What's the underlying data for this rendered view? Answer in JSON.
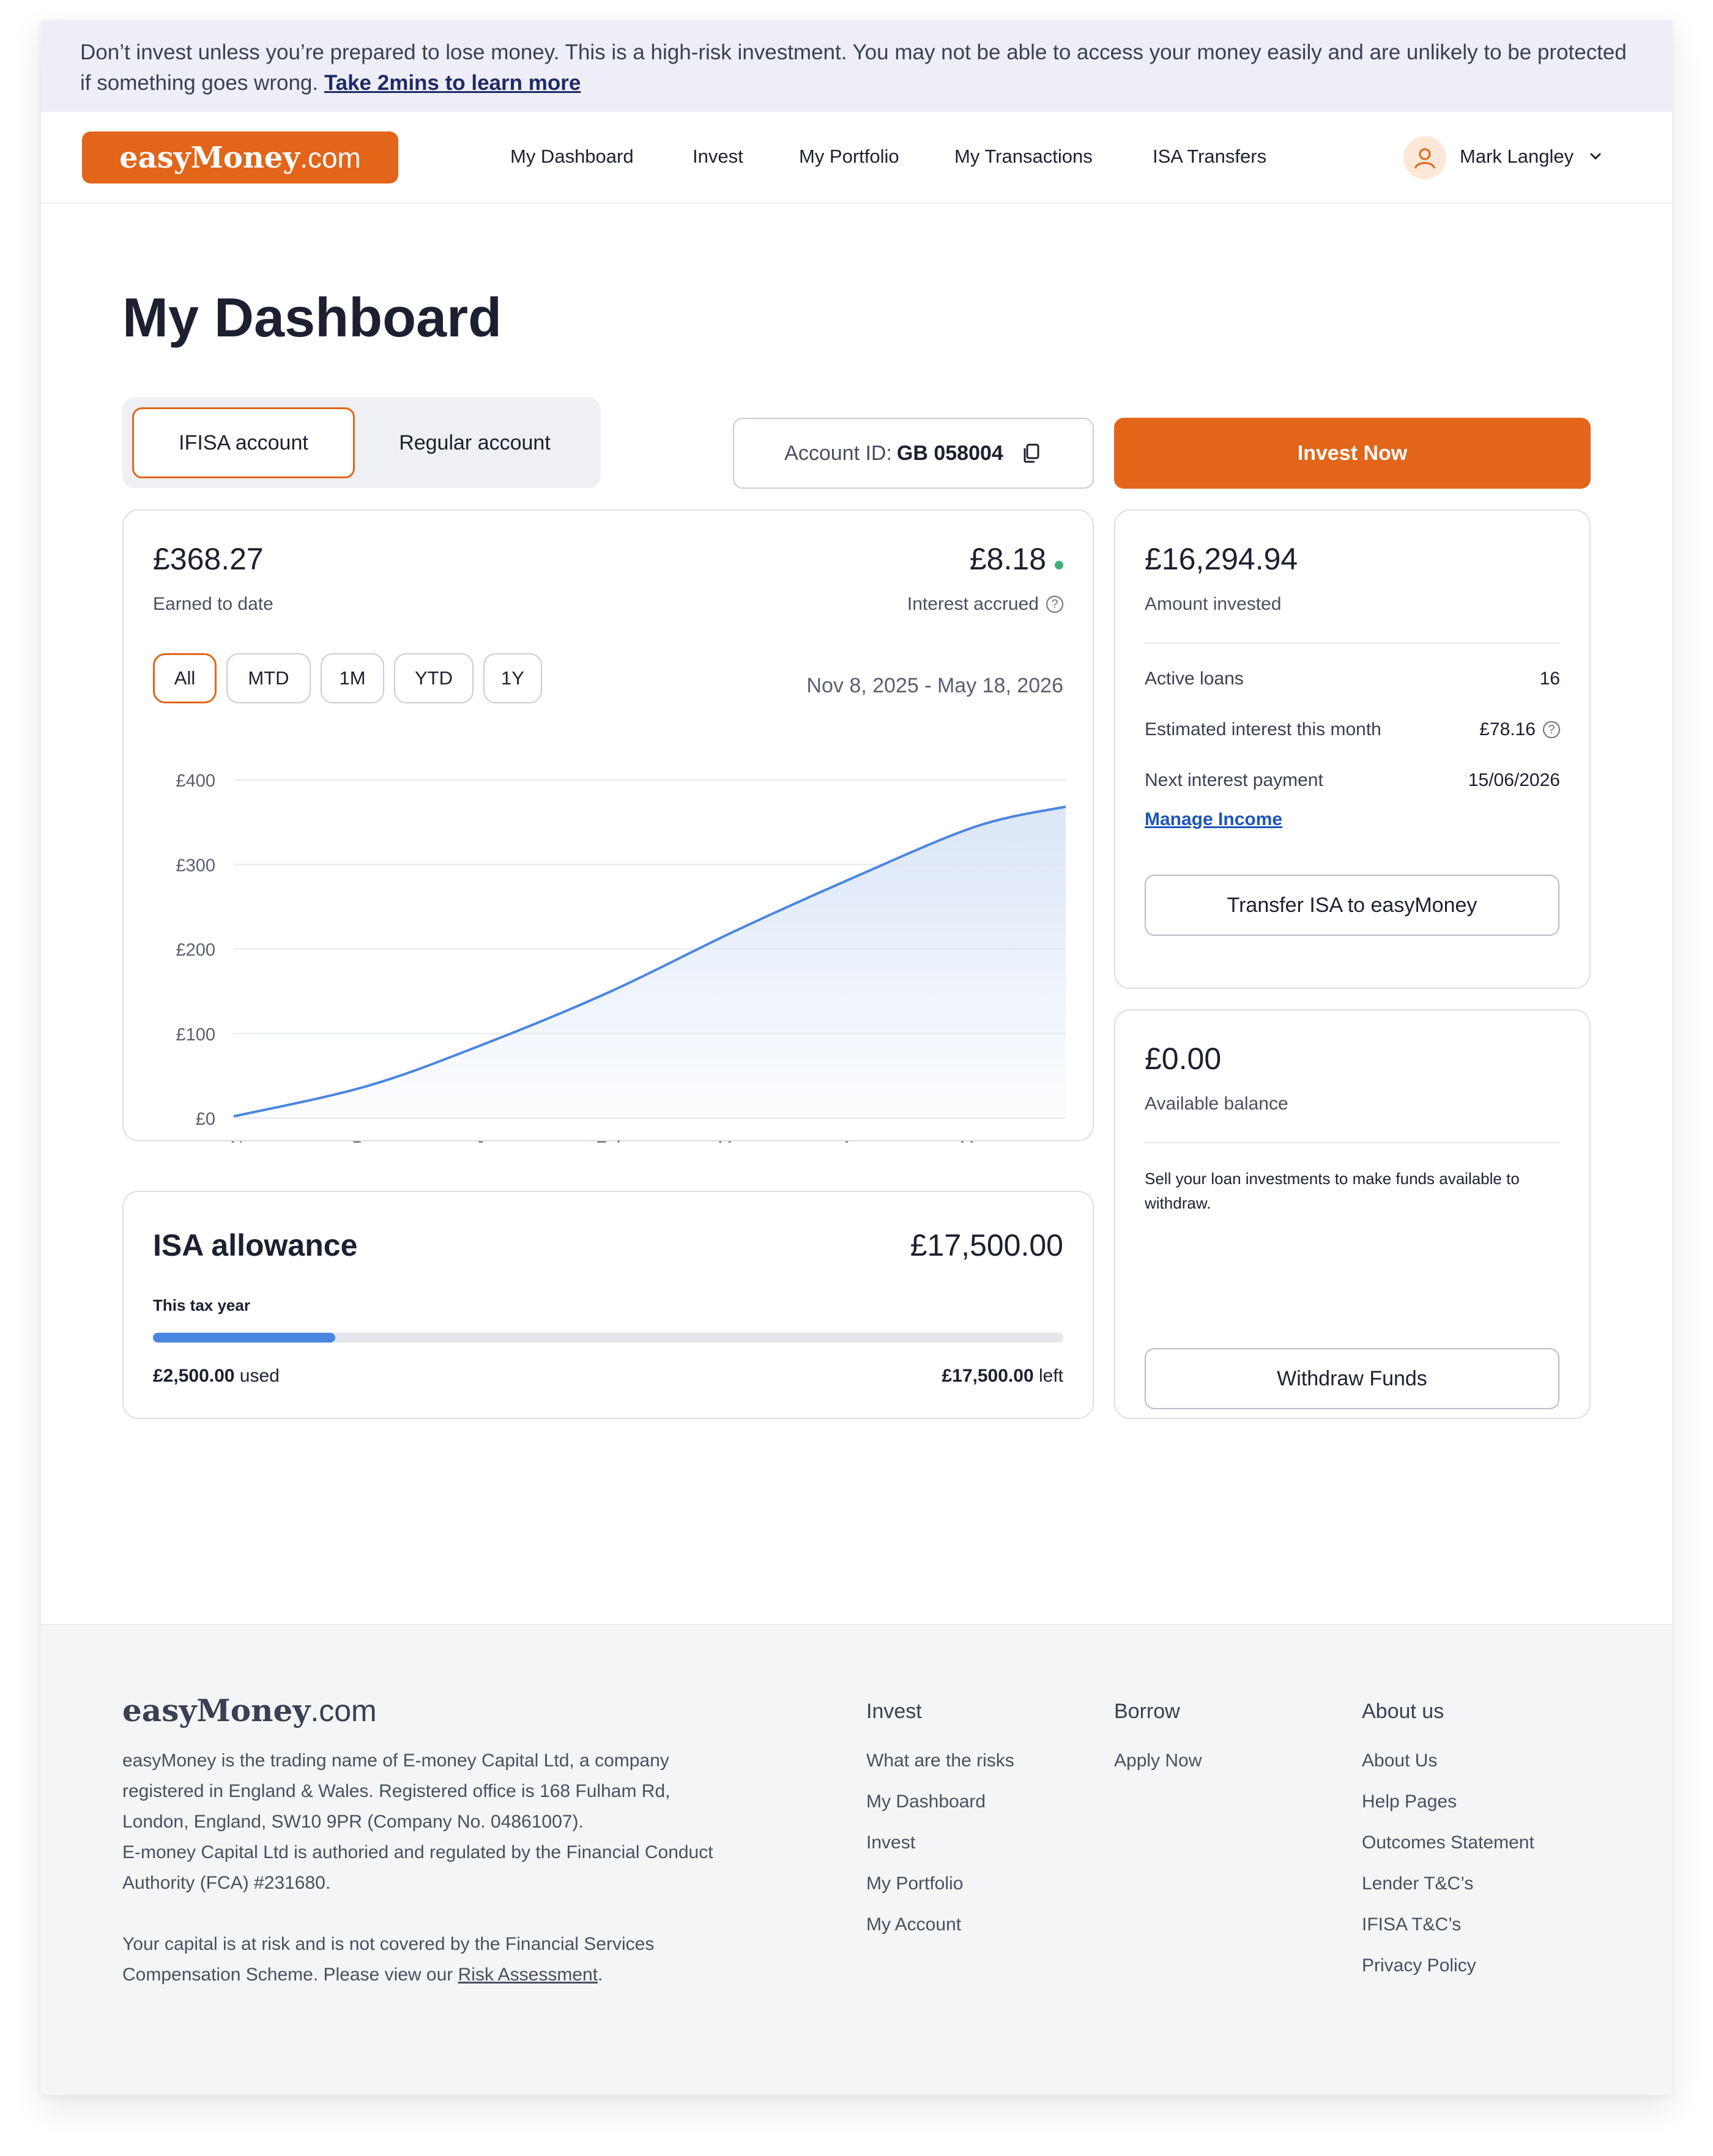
{
  "banner": {
    "text": "Don’t invest unless you’re prepared to lose money. This is a high-risk investment. You may not be able to access your money easily and are unlikely to be protected if something goes wrong. ",
    "link": "Take 2mins to learn more"
  },
  "header": {
    "logo_bold": "easyMoney",
    "logo_suffix": ".com",
    "nav": [
      "My Dashboard",
      "Invest",
      "My Portfolio",
      "My Transactions",
      "ISA Transfers"
    ],
    "user_name": "Mark Langley"
  },
  "page_title": "My Dashboard",
  "account_tabs": [
    "IFISA account",
    "Regular account"
  ],
  "account_id": {
    "label": "Account ID:",
    "value": "GB 058004"
  },
  "invest_now": "Invest Now",
  "earnings": {
    "earned": "£368.27",
    "earned_label": "Earned to date",
    "interest": "£8.18",
    "interest_label": "Interest accrued",
    "ranges": [
      "All",
      "MTD",
      "1M",
      "YTD",
      "1Y"
    ],
    "date_range": "Nov 8, 2025 - May 18, 2026"
  },
  "chart_data": {
    "type": "area",
    "x": [
      "Nov",
      "Dec",
      "Jan",
      "Feb",
      "Mar",
      "Apr",
      "May"
    ],
    "series": [
      {
        "values": [
          2,
          38,
          90,
          150,
          220,
          285,
          345
        ]
      }
    ],
    "y_ticks": [
      "£0",
      "£100",
      "£200",
      "£300",
      "£400"
    ],
    "ylim": [
      0,
      400
    ],
    "end_value": 368.27,
    "grid": true,
    "colors": {
      "line": "#4a86e0",
      "fill": "#dbe6f8"
    }
  },
  "isa": {
    "title": "ISA allowance",
    "total": "£17,500.00",
    "period": "This tax year",
    "used_amount": "£2,500.00",
    "used_label": " used",
    "left_amount": "£17,500.00",
    "left_label": " left",
    "progress_fraction": 0.2
  },
  "invested": {
    "amount": "£16,294.94",
    "label": "Amount invested",
    "rows": [
      {
        "label": "Active loans",
        "value": "16"
      },
      {
        "label": "Estimated interest this month",
        "value": "£78.16"
      },
      {
        "label": "Next interest payment",
        "value": "15/06/2026"
      }
    ],
    "manage_link": "Manage Income",
    "transfer_btn": "Transfer ISA to easyMoney"
  },
  "balance": {
    "amount": "£0.00",
    "label": "Available balance",
    "note": "Sell your loan investments to make funds available to withdraw.",
    "withdraw_btn": "Withdraw Funds"
  },
  "footer": {
    "logo_bold": "easyMoney",
    "logo_suffix": ".com",
    "para1": "easyMoney is the trading name of E-money Capital Ltd, a company registered in England & Wales. Registered office is 168 Fulham Rd, London, England, SW10 9PR (Company No. 04861007).",
    "para2": "E-money Capital Ltd is authoried and regulated by the Financial Conduct Authority (FCA) #231680.",
    "para3_text": "Your capital is at risk and is not covered by the Financial Services Compensation Scheme. Please view our ",
    "para3_link": "Risk Assessment",
    "para3_end": ".",
    "columns": [
      {
        "title": "Invest",
        "links": [
          "What are the risks",
          "My Dashboard",
          "Invest",
          "My Portfolio",
          "My Account"
        ]
      },
      {
        "title": "Borrow",
        "links": [
          "Apply Now"
        ]
      },
      {
        "title": "About us",
        "links": [
          "About Us",
          "Help Pages",
          "Outcomes Statement",
          "Lender T&C’s",
          "IFISA T&C’s",
          "Privacy Policy"
        ]
      }
    ]
  },
  "colors": {
    "brand": "#e2651a",
    "accent_blue": "#4a86e0",
    "status_green": "#3fae7a"
  }
}
